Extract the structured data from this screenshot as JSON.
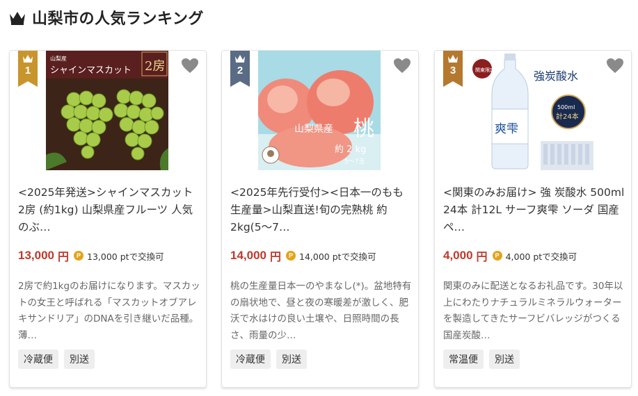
{
  "header": {
    "title": "山梨市の人気ランキング",
    "icon": "crown-icon"
  },
  "colors": {
    "rank1": "#c8952c",
    "rank2": "#5a6b85",
    "rank3": "#b5782f",
    "price": "#c0392b",
    "point_icon": "#e3a41b"
  },
  "point_icon_letter": "P",
  "products": [
    {
      "rank": "1",
      "name": "<2025年発送>シャインマスカット 2房 (約1kg) 山梨県産フルーツ 人気のぶ…",
      "price": "13,000",
      "price_unit": "円",
      "points": "13,000 ptで交換可",
      "description": "2房で約1kgのお届けになります。マスカットの女王と呼ばれる「マスカットオブアレキサンドリア」のDNAを引き継いだ品種。薄…",
      "tags": [
        "冷蔵便",
        "別送"
      ],
      "image_text": {
        "small": "山梨産",
        "main": "シャインマスカット",
        "count": "2房"
      }
    },
    {
      "rank": "2",
      "name": "<2025年先行受付><日本一のもも生産量>山梨直送!旬の完熟桃 約2kg(5〜7…",
      "price": "14,000",
      "price_unit": "円",
      "points": "14,000 ptで交換可",
      "description": "桃の生産量日本一のやまなし(*)。盆地特有の扇状地で、昼と夜の寒暖差が激しく、肥沃で水はけの良い土壌や、日照時間の長さ、雨量の少…",
      "tags": [
        "冷蔵便",
        "別送"
      ],
      "image_text": {
        "main": "山梨県産",
        "big": "桃",
        "weight": "約 2 kg",
        "count": "5〜7玉"
      }
    },
    {
      "rank": "3",
      "name": "<関東のみお届け> 強 炭酸水 500ml 24本 計12L サーフ爽雫 ソーダ 国産 ペ…",
      "price": "4,000",
      "price_unit": "円",
      "points": "4,000 ptで交換可",
      "description": "関東のみに配送となるお礼品です。30年以上にわたりナチュラルミネラルウォーターを製造してきたサーフビバレッジがつくる国産炭酸…",
      "tags": [
        "常温便",
        "別送"
      ],
      "image_text": {
        "badge": "関東限定",
        "title": "強炭酸水",
        "brand": "爽雫",
        "volume": "500ml",
        "count": "計24本"
      }
    }
  ]
}
